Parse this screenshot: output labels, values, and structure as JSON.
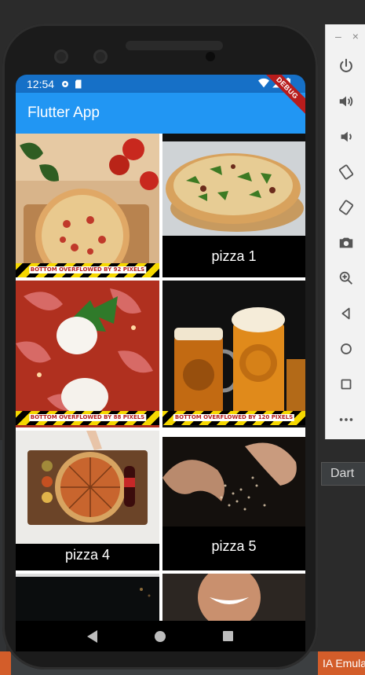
{
  "ide": {
    "language_label": "Dart",
    "bottom_right_label": "IA Emulator"
  },
  "status_bar": {
    "time": "12:54"
  },
  "app_bar": {
    "title": "Flutter App",
    "debug_banner": "DEBUG"
  },
  "grid": {
    "tiles": [
      {
        "caption": "",
        "overflow_text": "BOTTOM OVERFLOWED BY 92 PIXELS"
      },
      {
        "caption": "pizza 1",
        "overflow_text": ""
      },
      {
        "caption": "",
        "overflow_text": "BOTTOM OVERFLOWED BY 88 PIXELS"
      },
      {
        "caption": "",
        "overflow_text": "BOTTOM OVERFLOWED BY 120 PIXELS"
      },
      {
        "caption": "pizza 4",
        "overflow_text": ""
      },
      {
        "caption": "pizza 5",
        "overflow_text": ""
      },
      {
        "caption": "",
        "overflow_text": ""
      },
      {
        "caption": "",
        "overflow_text": ""
      }
    ]
  },
  "emulator_toolbar": {
    "buttons": [
      "power-icon",
      "volume-up-icon",
      "volume-down-icon",
      "rotate-left-icon",
      "rotate-right-icon",
      "camera-icon",
      "zoom-icon",
      "back-icon",
      "home-icon",
      "overview-icon",
      "more-icon"
    ]
  },
  "colors": {
    "appbar": "#2196f3",
    "status_bar": "#1670c7",
    "debug_banner": "#b71c1c",
    "overflow_yellow": "#f5d800"
  }
}
